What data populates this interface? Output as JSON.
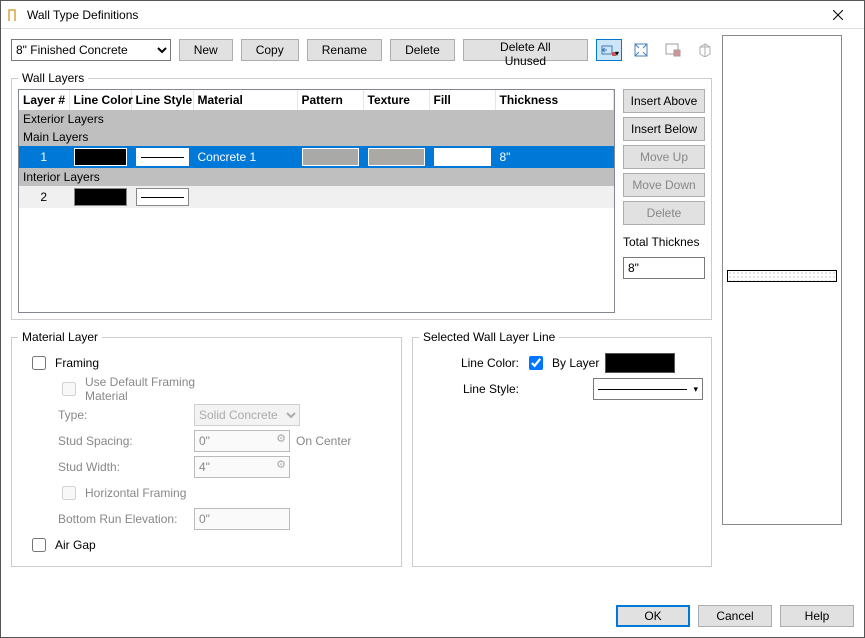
{
  "window": {
    "title": "Wall Type Definitions"
  },
  "toolbar": {
    "dropdown_value": "8\" Finished Concrete",
    "new": "New",
    "copy": "Copy",
    "rename": "Rename",
    "delete": "Delete",
    "delete_unused": "Delete All Unused"
  },
  "layers_panel": {
    "legend": "Wall Layers",
    "headers": {
      "num": "Layer #",
      "color": "Line Color",
      "style": "Line Style",
      "material": "Material",
      "pattern": "Pattern",
      "texture": "Texture",
      "fill": "Fill",
      "thickness": "Thickness"
    },
    "section_exterior": "Exterior Layers",
    "section_main": "Main Layers",
    "section_interior": "Interior Layers",
    "row1": {
      "num": "1",
      "material": "Concrete 1",
      "thickness": "8\""
    },
    "row2": {
      "num": "2"
    },
    "side": {
      "insert_above": "Insert Above",
      "insert_below": "Insert Below",
      "move_up": "Move Up",
      "move_down": "Move Down",
      "delete": "Delete",
      "total_label": "Total Thicknes",
      "total_value": "8\""
    }
  },
  "material_panel": {
    "legend": "Material Layer",
    "framing": "Framing",
    "use_default": "Use Default Framing Material",
    "type_label": "Type:",
    "type_value": "Solid Concrete",
    "stud_spacing_label": "Stud Spacing:",
    "stud_spacing_value": "0\"",
    "on_center": "On Center",
    "stud_width_label": "Stud Width:",
    "stud_width_value": "4\"",
    "horiz": "Horizontal Framing",
    "bottom_label": "Bottom Run Elevation:",
    "bottom_value": "0\"",
    "air_gap": "Air Gap"
  },
  "line_panel": {
    "legend": "Selected Wall Layer Line",
    "line_color_label": "Line Color:",
    "by_layer": "By Layer",
    "line_style_label": "Line Style:"
  },
  "footer": {
    "ok": "OK",
    "cancel": "Cancel",
    "help": "Help"
  }
}
